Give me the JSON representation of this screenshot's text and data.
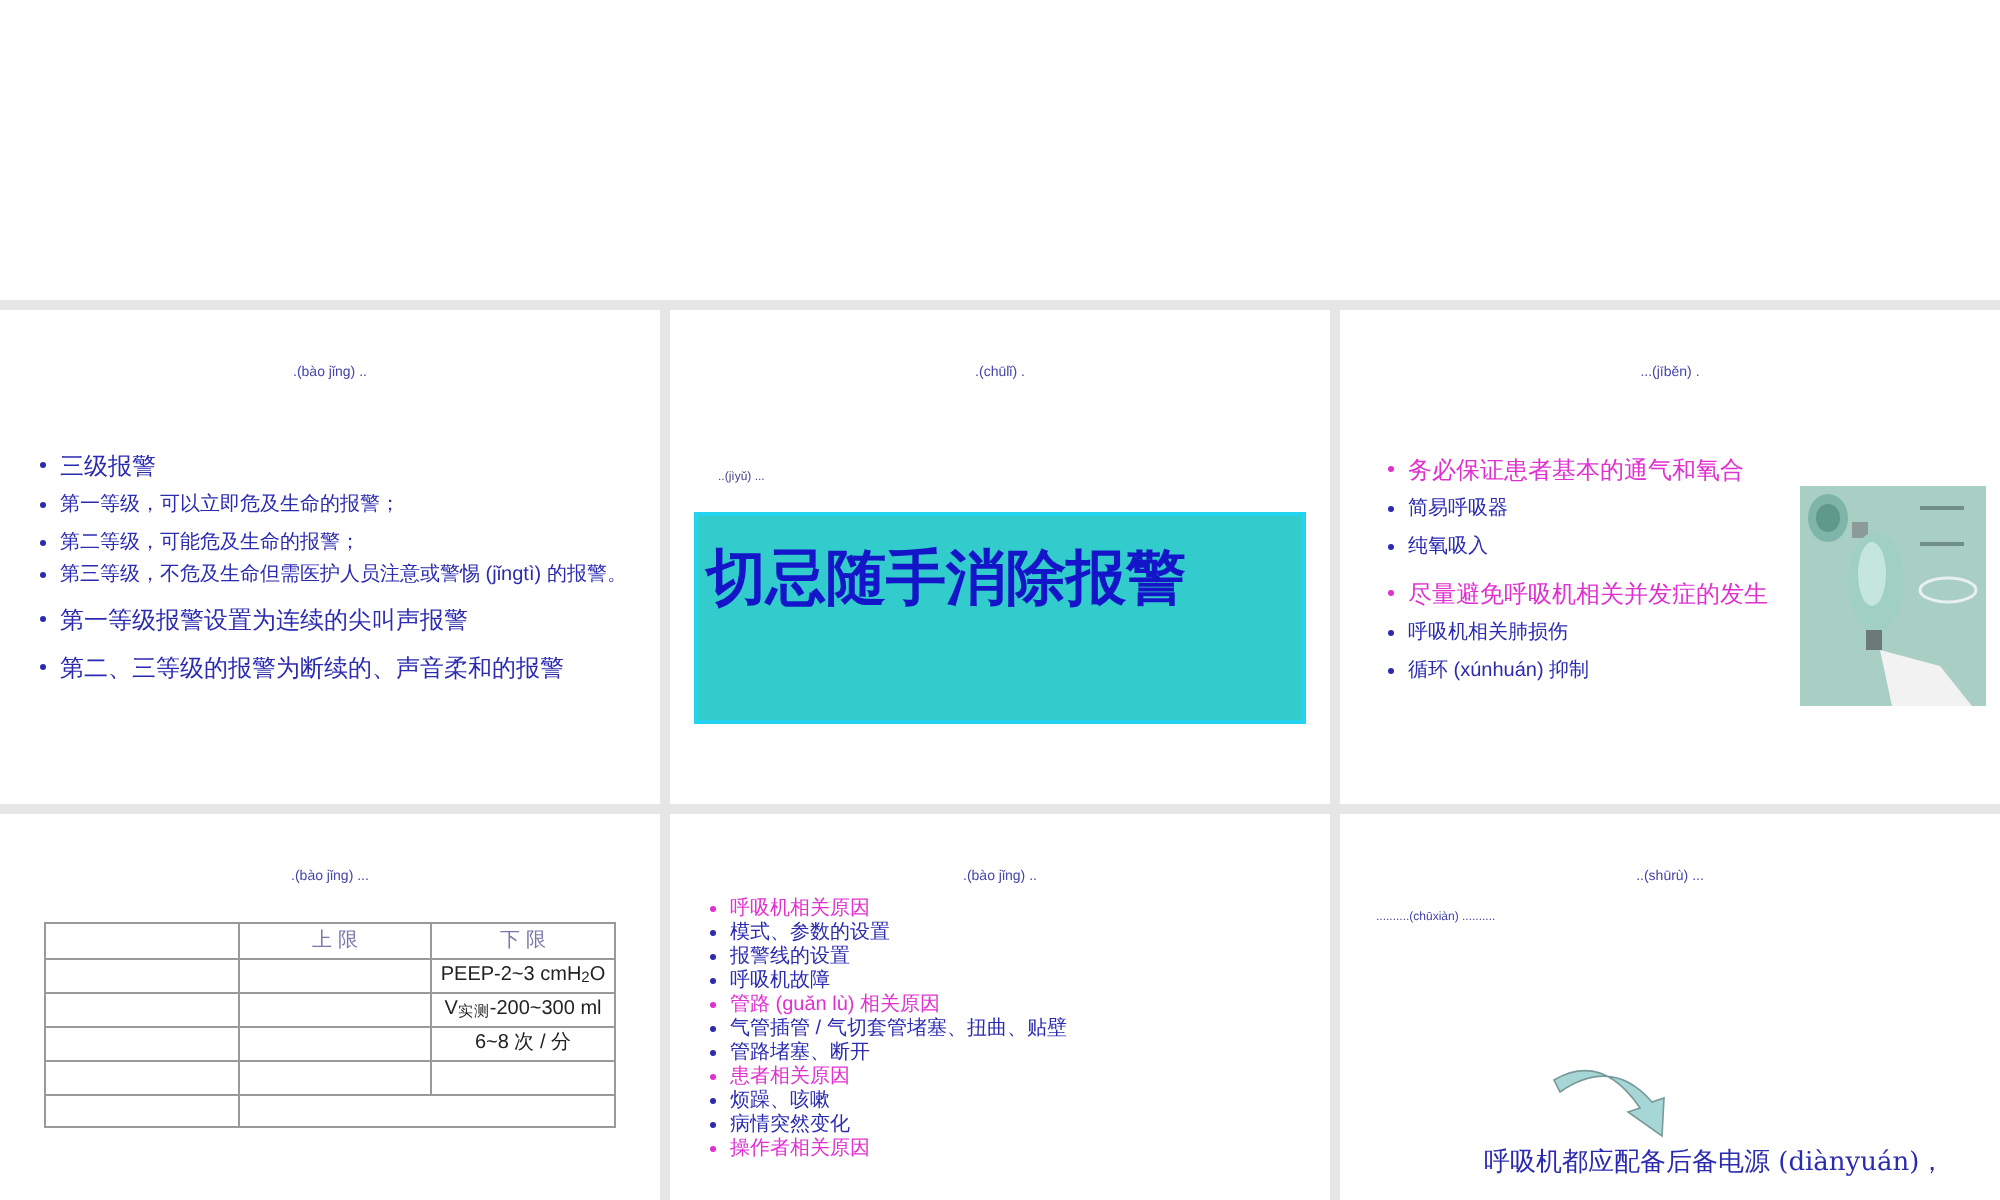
{
  "slides": [
    {
      "kind": "bullets",
      "title": ".(bào jǐng) ..",
      "bullets": [
        {
          "text": "三级报警",
          "kind": "large",
          "color": "#2b2bb0"
        },
        {
          "text": "第一等级，可以立即危及生命的报警；",
          "kind": "medium",
          "color": "#2b2bb0"
        },
        {
          "text": "第二等级，可能危及生命的报警；",
          "kind": "medium",
          "color": "#2b2bb0"
        },
        {
          "text": "第三等级，不危及生命但需医护人员注意或警惕 (jǐnɡtì) 的报警。",
          "kind": "small",
          "color": "#2b2bb0"
        },
        {
          "text": "第一等级报警设置为连续的尖叫声报警",
          "kind": "large",
          "color": "#2b2bb0"
        },
        {
          "text": "第二、三等级的报警为断续的、声音柔和的报警",
          "kind": "large",
          "color": "#2b2bb0"
        }
      ]
    },
    {
      "kind": "banner",
      "title": ".(chūlǐ) .",
      "note": "..(jìyǔ) ...",
      "banner": "切忌随手消除报警"
    },
    {
      "kind": "bullets_picture",
      "title": "...(jīběn) .",
      "bullets": [
        {
          "text": "务必保证患者基本的通气和氧合",
          "kind": "large",
          "color": "#e030d0"
        },
        {
          "text": "简易呼吸器",
          "kind": "medium",
          "color": "#2b2bb0"
        },
        {
          "text": "纯氧吸入",
          "kind": "medium",
          "color": "#2b2bb0"
        },
        {
          "text": "尽量避免呼吸机相关并发症的发生",
          "kind": "large",
          "color": "#e030d0"
        },
        {
          "text": "呼吸机相关肺损伤",
          "kind": "medium",
          "color": "#2b2bb0"
        },
        {
          "text": "循环 (xúnhuán) 抑制",
          "kind": "medium",
          "color": "#2b2bb0"
        }
      ]
    },
    {
      "kind": "table",
      "title": ".(bào jǐng) ...",
      "columns": [
        "上 限",
        "下 限"
      ],
      "rows": [
        {
          "lower": "PEEP-2~3 cmH$_{2}$O"
        },
        {
          "lower": "V$_{实测}$-200~300 ml"
        },
        {
          "lower": "6~8 次 / 分"
        }
      ]
    },
    {
      "kind": "bullets",
      "title": ".(bào jǐng) ..",
      "bullets": [
        {
          "text": "呼吸机相关原因",
          "kind": "medium",
          "color": "#e030d0"
        },
        {
          "text": "模式、参数的设置",
          "kind": "small",
          "color": "#2b2bb0"
        },
        {
          "text": "报警线的设置",
          "kind": "small",
          "color": "#2b2bb0"
        },
        {
          "text": "呼吸机故障",
          "kind": "small",
          "color": "#2b2bb0"
        },
        {
          "text": "管路 (guǎn lù) 相关原因",
          "kind": "medium",
          "color": "#e030d0"
        },
        {
          "text": "气管插管 / 气切套管堵塞、扭曲、贴壁",
          "kind": "small",
          "color": "#2b2bb0"
        },
        {
          "text": "管路堵塞、断开",
          "kind": "small",
          "color": "#2b2bb0"
        },
        {
          "text": "患者相关原因",
          "kind": "medium",
          "color": "#e030d0"
        },
        {
          "text": "烦躁、咳嗽",
          "kind": "small",
          "color": "#2b2bb0"
        },
        {
          "text": "病情突然变化",
          "kind": "small",
          "color": "#2b2bb0"
        },
        {
          "text": "操作者相关原因",
          "kind": "medium",
          "color": "#e030d0"
        }
      ]
    },
    {
      "kind": "arrow",
      "title": "..(shūrù) ...",
      "note": "..........(chūxiàn) ..........",
      "caption": "呼吸机都应配备后备电源 (diànyuán)，"
    }
  ]
}
